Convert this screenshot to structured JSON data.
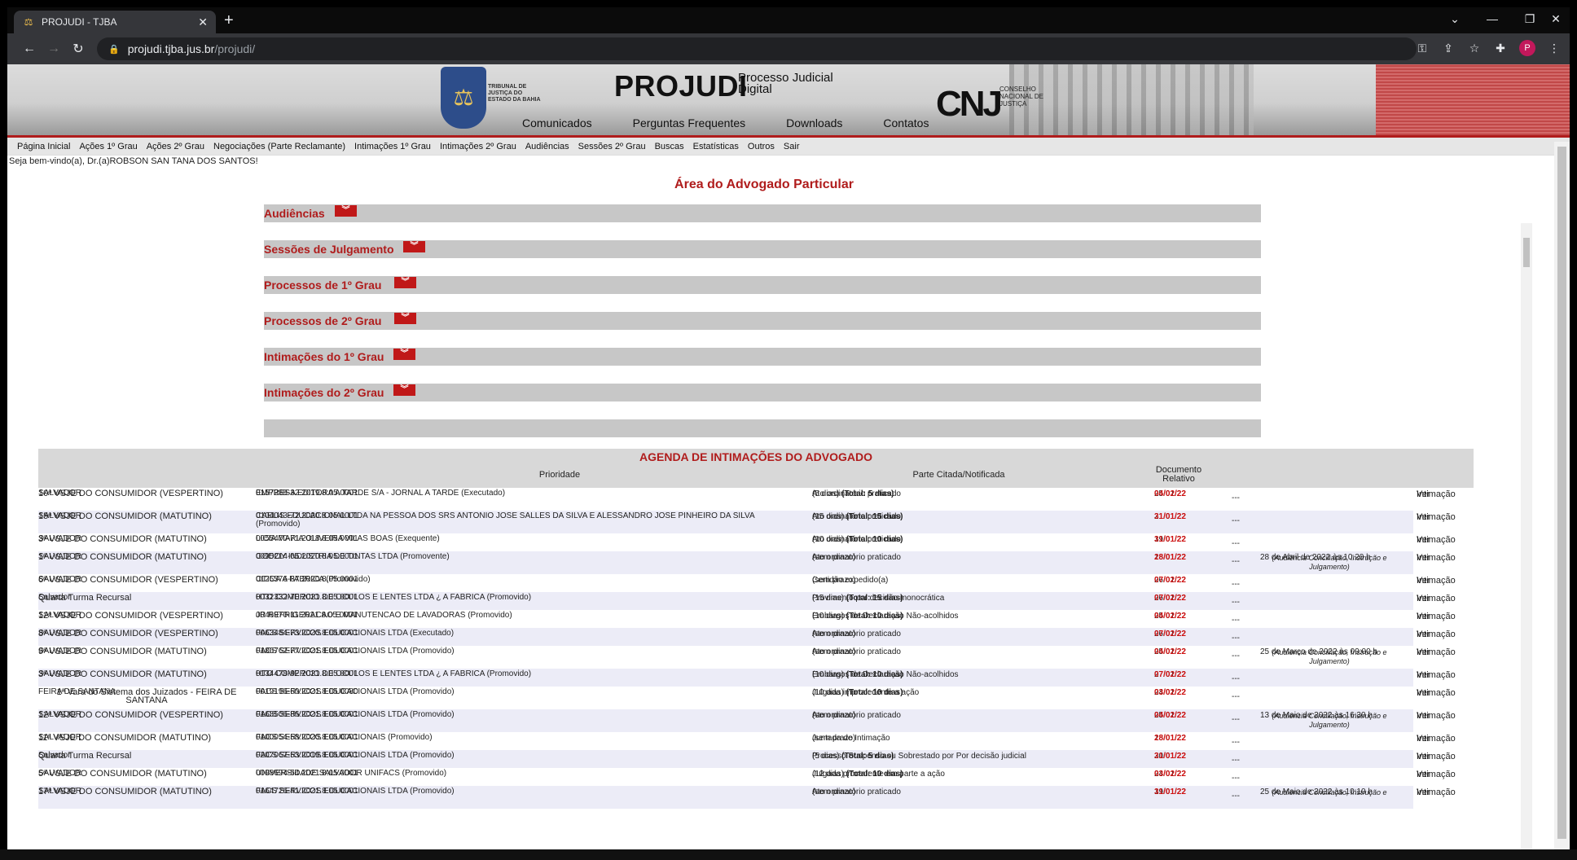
{
  "browser": {
    "tab_title": "PROJUDI - TJBA",
    "url_host": "projudi.tjba.jus.br",
    "url_path": "/projudi/",
    "profile_initial": "P"
  },
  "banner": {
    "tribunal": "TRIBUNAL DE JUSTIÇA DO ESTADO DA BAHIA",
    "logo": "PROJUDI",
    "logo_sub1": "Processo Judicial",
    "logo_sub2": "Digital",
    "cnj": "CNJ",
    "cnj_sub": "CONSELHO NACIONAL DE JUSTIÇA",
    "nav": [
      "Comunicados",
      "Perguntas Frequentes",
      "Downloads",
      "Contatos"
    ]
  },
  "menu": [
    "Página Inicial",
    "Ações 1º Grau",
    "Ações 2º Grau",
    "Negociações (Parte Reclamante)",
    "Intimações 1º Grau",
    "Intimações 2º Grau",
    "Audiências",
    "Sessões 2º Grau",
    "Buscas",
    "Estatísticas",
    "Outros",
    "Sair"
  ],
  "welcome": "Seja bem-vindo(a), Dr.(a)ROBSON SAN TANA DOS SANTOS!",
  "area_title": "Área do Advogado Particular",
  "sections": [
    "Audiências",
    "Sessões de Julgamento",
    "Processos de 1º Grau",
    "Processos de 2º Grau",
    "Intimações do 1º Grau",
    "Intimações do 2º Grau"
  ],
  "agenda": {
    "title": "AGENDA DE INTIMAÇÕES DO ADVOGADO",
    "col_prioridade": "Prioridade",
    "col_parte": "Parte Citada/Notificada",
    "col_doc1": "Documento",
    "col_doc2": "Relativo",
    "ver1": "Ver",
    "ver2": "Intimação",
    "rows": [
      {
        "loc1": "SALVADOR",
        "loc2": "10ª VSJE DO CONSUMIDOR (VESPERTINO)",
        "proc1": "0157288-32.2019.8.05.0001",
        "proc2": "EMPRESA EDITORA A TARDE S/A - JORNAL A TARDE (Executado)",
        "act1": "Ato ordinatório praticado",
        "act2": "(5 dias) (Total: 5 dias)",
        "d1": "25/01/22",
        "d2": "04/02/22",
        "aud": "",
        "aud2": ""
      },
      {
        "loc1": "SALVADOR",
        "loc2": "15ª VSJE DO CONSUMIDOR (MATUTINO)",
        "proc1": "0104043-72.2020.8.05.0001",
        "proc2": "CAELIS EDUCACIONAL LTDA NA PESSOA DOS SRS ANTONIO JOSE SALLES DA SILVA E ALESSANDRO JOSE PINHEIRO DA SILVA (Promovido)",
        "act1": "Ato ordinatório praticado",
        "act2": "(15 dias) (Total: 15 dias)",
        "d1": "21/01/22",
        "d2": "31/01/22",
        "aud": "",
        "aud2": ""
      },
      {
        "loc1": "SALVADOR",
        "loc2": "3ª VSJE DO CONSUMIDOR (MATUTINO)",
        "proc1": "0055470-71.2018.8.05.0001",
        "proc2": "LICIA MARIA OLIVEIRA VILAS BOAS (Exequente)",
        "act1": "Ato ordinatório praticado",
        "act2": "(10 dias) (Total: 10 dias)",
        "d1": "19/01/22",
        "d2": "31/01/22",
        "aud": "",
        "aud2": ""
      },
      {
        "loc1": "SALVADOR",
        "loc2": "1ª VSJE DO CONSUMIDOR (MATUTINO)",
        "proc1": "0095214-05.2020.8.05.0001",
        "proc2": "GODOY INDUSTRIA DE TINTAS LTDA (Promovente)",
        "act1": "Ato ordinatório praticado",
        "act2": "(sem prazo)",
        "d1": "18/01/22",
        "d2": "28/01/22",
        "aud": "28 de Abril de 2022 às 10:20 h",
        "aud2": "(Audiência Conciliação, Instrução e Julgamento)"
      },
      {
        "loc1": "SALVADOR",
        "loc2": "6ª VSJE DO CONSUMIDOR (VESPERTINO)",
        "proc1": "0125576-87.2020.8.05.0001",
        "proc2": "OTICA A FABRICA (Promovido)",
        "act1": "Certidão expedido(a)",
        "act2": "(sem prazo)",
        "d1": "26/01/22",
        "d2": "07/02/22",
        "aud": "",
        "aud2": ""
      },
      {
        "loc1": "Salvador",
        "loc2": "Quarta Turma Recursal",
        "proc1": "0032332-70.2021.8.05.0001",
        "proc2": "HTO COMERCIO DE OCULOS E LENTES LTDA ¿ A FABRICA (Promovido)",
        "act1": "Provimento por decisão monocrática",
        "act2": "(15 dias) (Total: 15 dias)",
        "d1": "26/01/22",
        "d2": "07/02/22",
        "aud": "",
        "aud2": ""
      },
      {
        "loc1": "SALVADOR",
        "loc2": "12ª VSJE DO CONSUMIDOR (VESPERTINO)",
        "proc1": "0046970-11.2021.8.05.0001",
        "proc2": "JR REFRIGERACAO E MANUTENCAO DE LAVADORAS (Promovido)",
        "act1": "Embargos de Declaração Não-acolhidos",
        "act2": "(10 dias) (Total: 10 dias)",
        "d1": "25/01/22",
        "d2": "04/02/22",
        "aud": "",
        "aud2": ""
      },
      {
        "loc1": "SALVADOR",
        "loc2": "8ª VSJE DO CONSUMIDOR (VESPERTINO)",
        "proc1": "0063484-73.2020.8.05.0001",
        "proc2": "FACS SERVICOS EDUCACIONAIS LTDA (Executado)",
        "act1": "Ato ordinatório praticado",
        "act2": "(sem prazo)",
        "d1": "26/01/22",
        "d2": "07/02/22",
        "aud": "",
        "aud2": ""
      },
      {
        "loc1": "SALVADOR",
        "loc2": "9ª VSJE DO CONSUMIDOR (MATUTINO)",
        "proc1": "0186762-77.2021.8.05.0001",
        "proc2": "FACS SERVICOS EDUCACIONAIS LTDA (Promovido)",
        "act1": "Ato ordinatório praticado",
        "act2": "(sem prazo)",
        "d1": "25/01/22",
        "d2": "04/02/22",
        "aud": "25 de Março de 2022 às 09:00 h",
        "aud2": "(Audiência Conciliação, Instrução e Julgamento)"
      },
      {
        "loc1": "SALVADOR",
        "loc2": "3ª VSJE DO CONSUMIDOR (MATUTINO)",
        "proc1": "0134478-92.2021.8.05.0001",
        "proc2": "HTO COMERCIO DE OCULOS E LENTES LTDA ¿ A FABRICA (Promovido)",
        "act1": "Embargos de Declaração Não-acolhidos",
        "act2": "(10 dias) (Total: 10 dias)",
        "d1": "27/01/22",
        "d2": "07/02/22",
        "aud": "",
        "aud2": ""
      },
      {
        "loc1": "FEIRA DE SANTANA",
        "loc2": "1ª Vara do Sistema dos Juizados - FEIRA DE SANTANA",
        "proc1": "0019196-60.2021.8.05.0080",
        "proc2": "FACS SERVICOS EDUCACIONAIS LTDA (Promovido)",
        "act1": "Julgada improcedente a ação",
        "act2": "(10 dias) (Total: 10 dias)",
        "d1": "24/01/22",
        "d2": "03/02/22",
        "aud": "",
        "aud2": ""
      },
      {
        "loc1": "SALVADOR",
        "loc2": "12ª VSJE DO CONSUMIDOR (VESPERTINO)",
        "proc1": "0168506-86.2021.8.05.0001",
        "proc2": "FACS SERVICOS EDUCACIONAIS LTDA (Promovido)",
        "act1": "Ato ordinatório praticado",
        "act2": "(sem prazo)",
        "d1": "25/01/22",
        "d2": "04/02/22",
        "aud": "13 de Maio de 2022 às 16:30 h",
        "aud2": "(Audiência Conciliação, Instrução e Julgamento)"
      },
      {
        "loc1": "SALVADOR",
        "loc2": "11ª VSJE DO CONSUMIDOR (MATUTINO)",
        "proc1": "0100054-58.2020.8.05.0001",
        "proc2": "FACS SERVICOS EDUCACIONAIS (Promovido)",
        "act1": "Juntada de Intimação",
        "act2": "(sem prazo)",
        "d1": "18/01/22",
        "d2": "28/01/22",
        "aud": "",
        "aud2": ""
      },
      {
        "loc1": "Salvador",
        "loc2": "Quarta Turma Recursal",
        "proc1": "0207067-53.2019.8.05.0001",
        "proc2": "FACS SERVICOS EDUCACIONAIS LTDA (Promovido)",
        "act1": "Processo Suspenso ou Sobrestado por Por decisão judicial",
        "act2": "(5 dias) (Total: 5 dias)",
        "d1": "20/01/22",
        "d2": "31/01/22",
        "aud": "",
        "aud2": ""
      },
      {
        "loc1": "SALVADOR",
        "loc2": "5ª VSJE DO CONSUMIDOR (MATUTINO)",
        "proc1": "0098694-54.2021.8.05.0001",
        "proc2": "UNIVERSIDADE SALVADOR UNIFACS (Promovido)",
        "act1": "Julgada procedente em parte a ação",
        "act2": "(12 dias) (Total: 10 dias)",
        "d1": "24/01/22",
        "d2": "03/02/22",
        "aud": "",
        "aud2": ""
      },
      {
        "loc1": "SALVADOR",
        "loc2": "17ª VSJE DO CONSUMIDOR (MATUTINO)",
        "proc1": "0164726-41.2021.8.05.0001",
        "proc2": "FACS SERVICOS EDUCACIONAIS LTDA (Promovido)",
        "act1": "Ato ordinatório praticado",
        "act2": "(sem prazo)",
        "d1": "19/01/22",
        "d2": "31/01/22",
        "aud": "25 de Maio de 2022 às 10:10 h",
        "aud2": "(Audiência Conciliação, Instrução e"
      }
    ]
  }
}
